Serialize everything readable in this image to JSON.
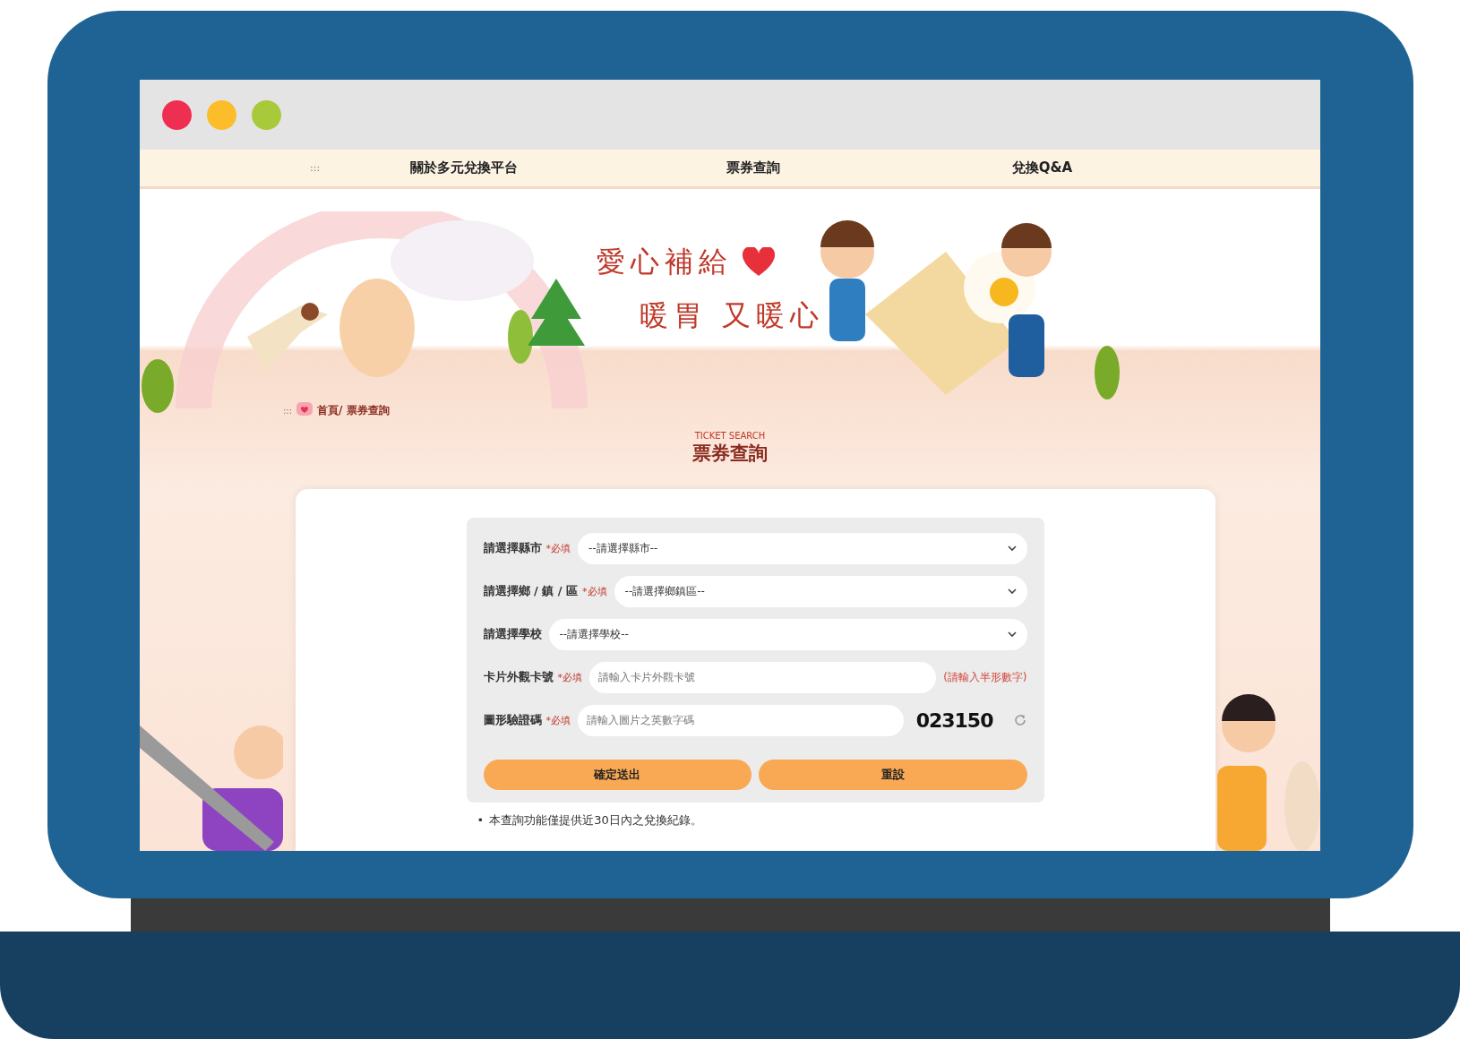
{
  "browser": {
    "buttons": [
      {
        "color": "#ef2f52"
      },
      {
        "color": "#fbbd2a"
      },
      {
        "color": "#a8c93a"
      }
    ]
  },
  "nav": {
    "menu_icon": ":::",
    "items": [
      {
        "label": "關於多元兌換平台"
      },
      {
        "label": "票券查詢"
      },
      {
        "label": "兌換Q&A"
      }
    ]
  },
  "hero": {
    "lines": [
      "愛心補給",
      "暖胃 又暖心"
    ]
  },
  "breadcrumb": {
    "menu_icon": ":::",
    "items": [
      "首頁/",
      "票券查詢"
    ]
  },
  "section": {
    "subtitle": "TICKET SEARCH",
    "title": "票券查詢"
  },
  "form": {
    "rows": [
      {
        "kind": "select",
        "label": "請選擇縣市",
        "required": "*必填",
        "value": "--請選擇縣市--"
      },
      {
        "kind": "select",
        "label": "請選擇鄉 / 鎮 / 區",
        "required": "*必填",
        "value": "--請選擇鄉鎮區--"
      },
      {
        "kind": "select",
        "label": "請選擇學校",
        "value": "--請選擇學校--"
      },
      {
        "kind": "input",
        "label": "卡片外觀卡號",
        "required": "*必填",
        "placeholder": "請輸入卡片外觀卡號",
        "hint": "(請輸入半形數字)"
      },
      {
        "kind": "captcha",
        "label": "圖形驗證碼",
        "required": "*必填",
        "placeholder": "請輸入圖片之英數字碼",
        "code": "023150"
      }
    ],
    "buttons": [
      "確定送出",
      "重設"
    ]
  },
  "notes": [
    {
      "bullet": "•",
      "text": "本查詢功能僅提供近30日內之兌換紀錄。"
    }
  ]
}
